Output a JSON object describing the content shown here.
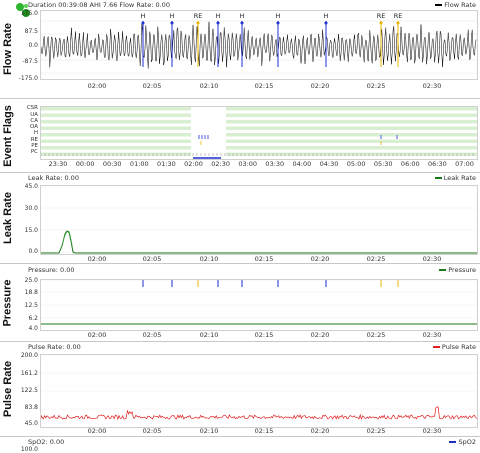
{
  "flow": {
    "title": "Flow Rate",
    "header": "Duration 00:39:08 AHI 7.66 Flow Rate: 0.00",
    "legend": "Flow Rate",
    "yticks": [
      "175.0",
      "87.5",
      "0.0",
      "-87.5",
      "-175.0"
    ],
    "xticks": [
      "02:00",
      "02:05",
      "02:10",
      "02:15",
      "02:20",
      "02:25",
      "02:30"
    ],
    "event_labels": [
      "H",
      "H",
      "RE",
      "H",
      "H",
      "H",
      "H",
      "RE",
      "RE"
    ],
    "colors": {
      "line": "#000000",
      "hypopnea": "#1f2fd6",
      "rera": "#e8b400"
    }
  },
  "flags": {
    "title": "Event Flags",
    "rows": [
      "CSR",
      "UA",
      "CA",
      "OA",
      "H",
      "RE",
      "PE",
      "PC"
    ],
    "xticks": [
      "23:30",
      "00:00",
      "00:30",
      "01:00",
      "01:30",
      "02:00",
      "02:30",
      "03:00",
      "03:30",
      "04:00",
      "04:30",
      "05:00",
      "05:30",
      "06:00",
      "06:30",
      "07:00"
    ],
    "colors": {
      "band": "#d9efd1",
      "selection": "#ffffff"
    }
  },
  "leak": {
    "title": "Leak Rate",
    "header": "Leak Rate: 0.00",
    "legend": "Leak Rate",
    "yticks": [
      "45.0",
      "30.0",
      "15.0",
      "0.0"
    ],
    "xticks": [
      "02:00",
      "02:05",
      "02:10",
      "02:15",
      "02:20",
      "02:25",
      "02:30"
    ],
    "colors": {
      "line": "#1a7a1a"
    }
  },
  "pressure": {
    "title": "Pressure",
    "header": "Pressure: 0.00",
    "legend": "Pressure",
    "yticks": [
      "25.0",
      "18.8",
      "12.5",
      "6.2",
      "4.0"
    ],
    "xticks": [
      "02:00",
      "02:05",
      "02:10",
      "02:15",
      "02:20",
      "02:25",
      "02:30"
    ],
    "colors": {
      "line": "#1a7a1a"
    }
  },
  "pulse": {
    "title": "Pulse Rate",
    "header": "Pulse Rate: 0.00",
    "legend": "Pulse Rate",
    "yticks": [
      "200.0",
      "161.2",
      "122.5",
      "83.8",
      "45.0"
    ],
    "xticks": [
      "02:00",
      "02:05",
      "02:10",
      "02:15",
      "02:20",
      "02:25",
      "02:30"
    ],
    "colors": {
      "line": "#e02020"
    }
  },
  "spo2": {
    "header": "SpO2: 0.00",
    "legend": "SpO2",
    "yticks": [
      "100.0"
    ],
    "colors": {
      "line": "#2030c0"
    }
  }
}
